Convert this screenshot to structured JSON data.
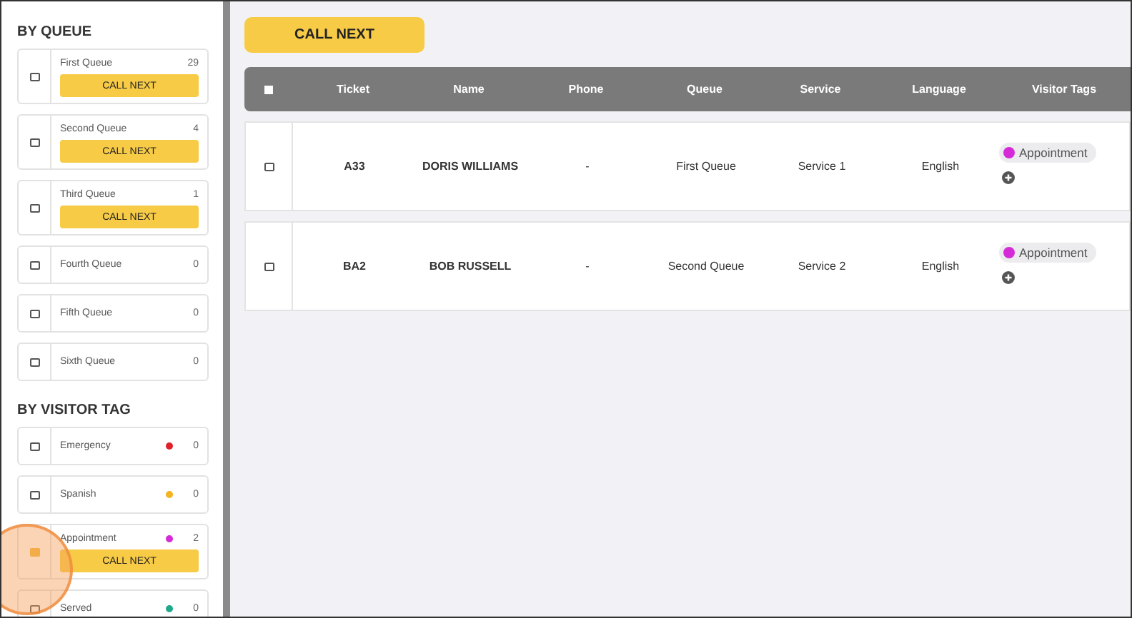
{
  "sidebar": {
    "sections": [
      {
        "title": "BY QUEUE",
        "items": [
          {
            "label": "First Queue",
            "count": "29",
            "checked": false,
            "button": "CALL NEXT"
          },
          {
            "label": "Second Queue",
            "count": "4",
            "checked": false,
            "button": "CALL NEXT"
          },
          {
            "label": "Third Queue",
            "count": "1",
            "checked": false,
            "button": "CALL NEXT"
          },
          {
            "label": "Fourth Queue",
            "count": "0",
            "checked": false
          },
          {
            "label": "Fifth Queue",
            "count": "0",
            "checked": false
          },
          {
            "label": "Sixth Queue",
            "count": "0",
            "checked": false
          }
        ]
      },
      {
        "title": "BY VISITOR TAG",
        "items": [
          {
            "label": "Emergency",
            "count": "0",
            "checked": false,
            "color": "#e0202a"
          },
          {
            "label": "Spanish",
            "count": "0",
            "checked": false,
            "color": "#f5b320"
          },
          {
            "label": "Appointment",
            "count": "2",
            "checked": true,
            "color": "#d42ad8",
            "button": "CALL NEXT"
          },
          {
            "label": "Served",
            "count": "0",
            "checked": false,
            "color": "#20a88a"
          }
        ]
      }
    ]
  },
  "click_indicator": {
    "shown": true
  },
  "call_next_button": "CALL NEXT",
  "table": {
    "columns": [
      "Ticket",
      "Name",
      "Phone",
      "Queue",
      "Service",
      "Language",
      "Visitor Tags"
    ],
    "rows": [
      {
        "checked": false,
        "cells": [
          "A33",
          "DORIS WILLIAMS",
          "-",
          "First Queue",
          "Service 1",
          "English"
        ],
        "tags": [
          {
            "label": "Appointment",
            "color": "#d42ad8"
          }
        ]
      },
      {
        "checked": false,
        "cells": [
          "BA2",
          "BOB RUSSELL",
          "-",
          "Second Queue",
          "Service 2",
          "English"
        ],
        "tags": [
          {
            "label": "Appointment",
            "color": "#d42ad8"
          }
        ]
      }
    ]
  }
}
